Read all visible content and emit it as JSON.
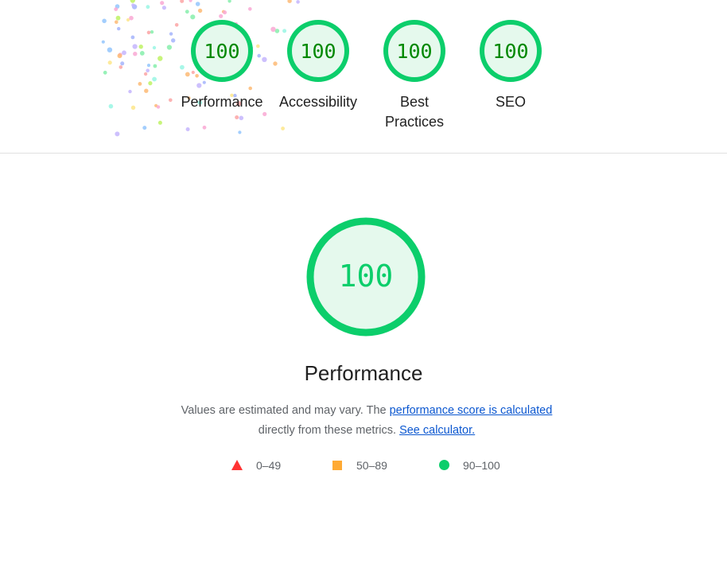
{
  "summary_gauges": [
    {
      "score": "100",
      "label": "Performance"
    },
    {
      "score": "100",
      "label": "Accessibility"
    },
    {
      "score": "100",
      "label": "Best Practices"
    },
    {
      "score": "100",
      "label": "SEO"
    }
  ],
  "main": {
    "score": "100",
    "title": "Performance",
    "desc_before": "Values are estimated and may vary. The ",
    "desc_link": "performance score is calculated",
    "desc_middle": " directly from these metrics. ",
    "desc_calc_link": "See calculator."
  },
  "legend": [
    {
      "shape": "triangle-icon",
      "range": "0–49",
      "color": "#ff3333"
    },
    {
      "shape": "square-icon",
      "range": "50–89",
      "color": "#ffaa33"
    },
    {
      "shape": "circle-icon",
      "range": "90–100",
      "color": "#0cce6b"
    }
  ],
  "colors": {
    "pass_ring": "#0cce6b",
    "pass_fill": "#e5f9ed",
    "pass_text": "#008800"
  }
}
